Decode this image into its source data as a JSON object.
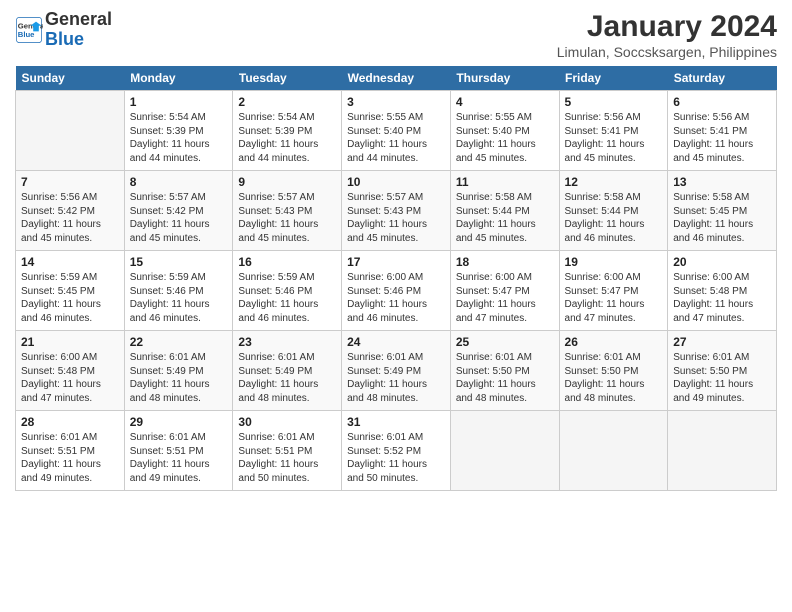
{
  "logo": {
    "line1": "General",
    "line2": "Blue"
  },
  "title": "January 2024",
  "subtitle": "Limulan, Soccsksargen, Philippines",
  "weekdays": [
    "Sunday",
    "Monday",
    "Tuesday",
    "Wednesday",
    "Thursday",
    "Friday",
    "Saturday"
  ],
  "weeks": [
    [
      {
        "day": "",
        "info": ""
      },
      {
        "day": "1",
        "info": "Sunrise: 5:54 AM\nSunset: 5:39 PM\nDaylight: 11 hours\nand 44 minutes."
      },
      {
        "day": "2",
        "info": "Sunrise: 5:54 AM\nSunset: 5:39 PM\nDaylight: 11 hours\nand 44 minutes."
      },
      {
        "day": "3",
        "info": "Sunrise: 5:55 AM\nSunset: 5:40 PM\nDaylight: 11 hours\nand 44 minutes."
      },
      {
        "day": "4",
        "info": "Sunrise: 5:55 AM\nSunset: 5:40 PM\nDaylight: 11 hours\nand 45 minutes."
      },
      {
        "day": "5",
        "info": "Sunrise: 5:56 AM\nSunset: 5:41 PM\nDaylight: 11 hours\nand 45 minutes."
      },
      {
        "day": "6",
        "info": "Sunrise: 5:56 AM\nSunset: 5:41 PM\nDaylight: 11 hours\nand 45 minutes."
      }
    ],
    [
      {
        "day": "7",
        "info": "Sunrise: 5:56 AM\nSunset: 5:42 PM\nDaylight: 11 hours\nand 45 minutes."
      },
      {
        "day": "8",
        "info": "Sunrise: 5:57 AM\nSunset: 5:42 PM\nDaylight: 11 hours\nand 45 minutes."
      },
      {
        "day": "9",
        "info": "Sunrise: 5:57 AM\nSunset: 5:43 PM\nDaylight: 11 hours\nand 45 minutes."
      },
      {
        "day": "10",
        "info": "Sunrise: 5:57 AM\nSunset: 5:43 PM\nDaylight: 11 hours\nand 45 minutes."
      },
      {
        "day": "11",
        "info": "Sunrise: 5:58 AM\nSunset: 5:44 PM\nDaylight: 11 hours\nand 45 minutes."
      },
      {
        "day": "12",
        "info": "Sunrise: 5:58 AM\nSunset: 5:44 PM\nDaylight: 11 hours\nand 46 minutes."
      },
      {
        "day": "13",
        "info": "Sunrise: 5:58 AM\nSunset: 5:45 PM\nDaylight: 11 hours\nand 46 minutes."
      }
    ],
    [
      {
        "day": "14",
        "info": "Sunrise: 5:59 AM\nSunset: 5:45 PM\nDaylight: 11 hours\nand 46 minutes."
      },
      {
        "day": "15",
        "info": "Sunrise: 5:59 AM\nSunset: 5:46 PM\nDaylight: 11 hours\nand 46 minutes."
      },
      {
        "day": "16",
        "info": "Sunrise: 5:59 AM\nSunset: 5:46 PM\nDaylight: 11 hours\nand 46 minutes."
      },
      {
        "day": "17",
        "info": "Sunrise: 6:00 AM\nSunset: 5:46 PM\nDaylight: 11 hours\nand 46 minutes."
      },
      {
        "day": "18",
        "info": "Sunrise: 6:00 AM\nSunset: 5:47 PM\nDaylight: 11 hours\nand 47 minutes."
      },
      {
        "day": "19",
        "info": "Sunrise: 6:00 AM\nSunset: 5:47 PM\nDaylight: 11 hours\nand 47 minutes."
      },
      {
        "day": "20",
        "info": "Sunrise: 6:00 AM\nSunset: 5:48 PM\nDaylight: 11 hours\nand 47 minutes."
      }
    ],
    [
      {
        "day": "21",
        "info": "Sunrise: 6:00 AM\nSunset: 5:48 PM\nDaylight: 11 hours\nand 47 minutes."
      },
      {
        "day": "22",
        "info": "Sunrise: 6:01 AM\nSunset: 5:49 PM\nDaylight: 11 hours\nand 48 minutes."
      },
      {
        "day": "23",
        "info": "Sunrise: 6:01 AM\nSunset: 5:49 PM\nDaylight: 11 hours\nand 48 minutes."
      },
      {
        "day": "24",
        "info": "Sunrise: 6:01 AM\nSunset: 5:49 PM\nDaylight: 11 hours\nand 48 minutes."
      },
      {
        "day": "25",
        "info": "Sunrise: 6:01 AM\nSunset: 5:50 PM\nDaylight: 11 hours\nand 48 minutes."
      },
      {
        "day": "26",
        "info": "Sunrise: 6:01 AM\nSunset: 5:50 PM\nDaylight: 11 hours\nand 48 minutes."
      },
      {
        "day": "27",
        "info": "Sunrise: 6:01 AM\nSunset: 5:50 PM\nDaylight: 11 hours\nand 49 minutes."
      }
    ],
    [
      {
        "day": "28",
        "info": "Sunrise: 6:01 AM\nSunset: 5:51 PM\nDaylight: 11 hours\nand 49 minutes."
      },
      {
        "day": "29",
        "info": "Sunrise: 6:01 AM\nSunset: 5:51 PM\nDaylight: 11 hours\nand 49 minutes."
      },
      {
        "day": "30",
        "info": "Sunrise: 6:01 AM\nSunset: 5:51 PM\nDaylight: 11 hours\nand 50 minutes."
      },
      {
        "day": "31",
        "info": "Sunrise: 6:01 AM\nSunset: 5:52 PM\nDaylight: 11 hours\nand 50 minutes."
      },
      {
        "day": "",
        "info": ""
      },
      {
        "day": "",
        "info": ""
      },
      {
        "day": "",
        "info": ""
      }
    ]
  ]
}
